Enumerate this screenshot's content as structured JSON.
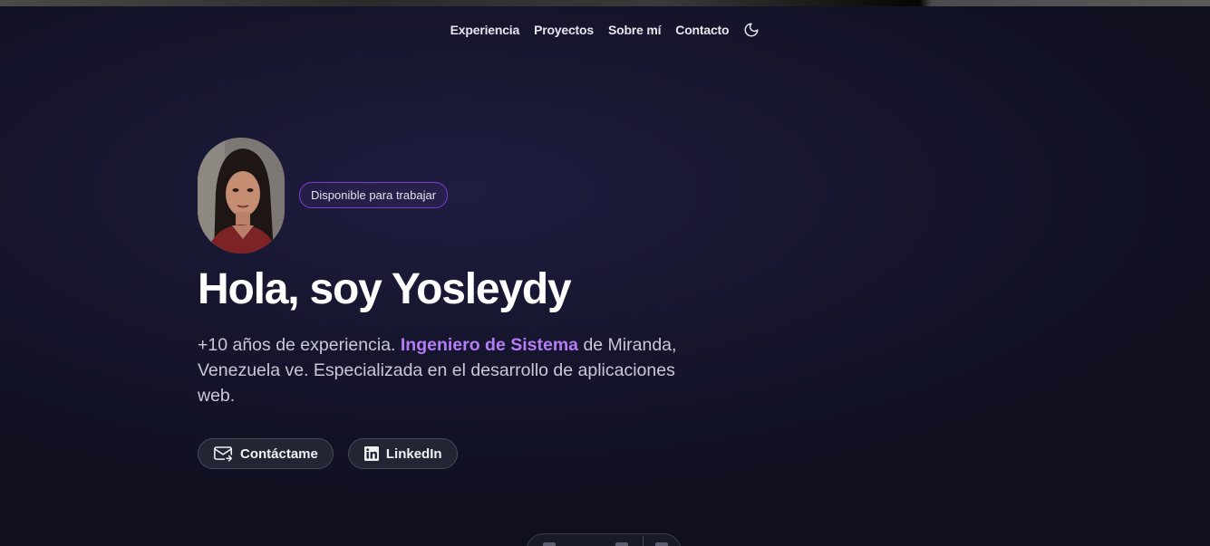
{
  "nav": {
    "items": [
      {
        "label": "Experiencia"
      },
      {
        "label": "Proyectos"
      },
      {
        "label": "Sobre mí"
      },
      {
        "label": "Contacto"
      }
    ],
    "theme_toggle_icon": "moon-icon"
  },
  "hero": {
    "badge": "Disponible para trabajar",
    "title": "Hola, soy Yosleydy",
    "description": {
      "before": "+10 años de experiencia. ",
      "highlight": "Ingeniero de Sistema",
      "after": " de Miranda, Venezuela ve. Especializada en el desarrollo de aplicaciones web."
    },
    "buttons": {
      "contact_label": "Contáctame",
      "contact_icon": "mail-icon",
      "linkedin_label": "LinkedIn",
      "linkedin_icon": "linkedin-icon"
    }
  },
  "colors": {
    "accent": "#b57cf5",
    "badge_border": "#7b3fd0",
    "background": "#17162f"
  }
}
